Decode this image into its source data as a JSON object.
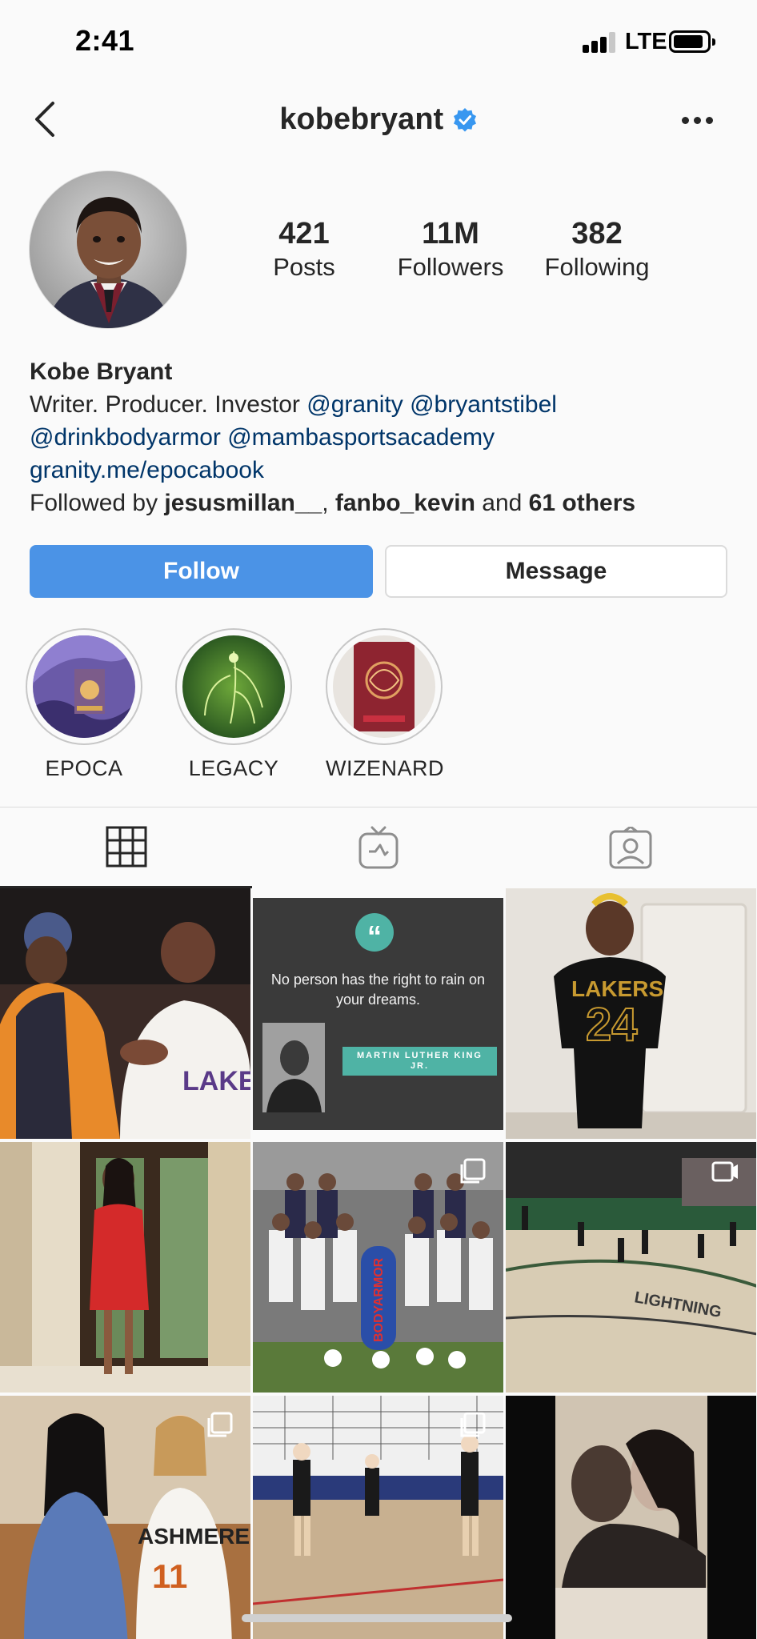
{
  "status_bar": {
    "time": "2:41",
    "network": "LTE"
  },
  "nav": {
    "username": "kobebryant",
    "verified_icon": "verified-badge-icon",
    "back_icon": "chevron-left-icon",
    "more_icon": "more-dots-icon"
  },
  "profile": {
    "stats": [
      {
        "value": "421",
        "label": "Posts"
      },
      {
        "value": "11M",
        "label": "Followers"
      },
      {
        "value": "382",
        "label": "Following"
      }
    ],
    "name": "Kobe Bryant",
    "bio_prefix": "Writer. Producer. Investor ",
    "bio_mention_1": "@granity",
    "bio_mention_2": "@bryantstibel",
    "bio_mention_3": "@drinkbodyarmor",
    "bio_mention_4": "@mambasportsacademy",
    "website": "granity.me/epocabook",
    "followed_by_prefix": "Followed by ",
    "followed_by_user_1": "jesusmillan__",
    "followed_by_sep": ", ",
    "followed_by_user_2": "fanbo_kevin",
    "followed_by_and": " and ",
    "followed_by_others": "61 others"
  },
  "actions": {
    "follow_label": "Follow",
    "message_label": "Message"
  },
  "highlights": [
    {
      "label": "EPOCA"
    },
    {
      "label": "LEGACY"
    },
    {
      "label": "WIZENARD"
    }
  ],
  "tabs": {
    "grid_icon": "grid-icon",
    "igtv_icon": "igtv-icon",
    "tagged_icon": "tagged-icon"
  },
  "posts": {
    "quote_text": "No person has the right to rain on your dreams.",
    "quote_author": "MARTIN LUTHER KING JR.",
    "jersey_text_1": "LAKERS",
    "jersey_number_1": "24",
    "jersey_text_2": "ASHMERE",
    "jersey_number_2": "11",
    "lightning_text": "LIGHTNING",
    "bodyarmor_text": "BODYARMOR"
  },
  "colors": {
    "follow_button": "#4b93e6",
    "link": "#003569",
    "verified": "#3897f0"
  }
}
